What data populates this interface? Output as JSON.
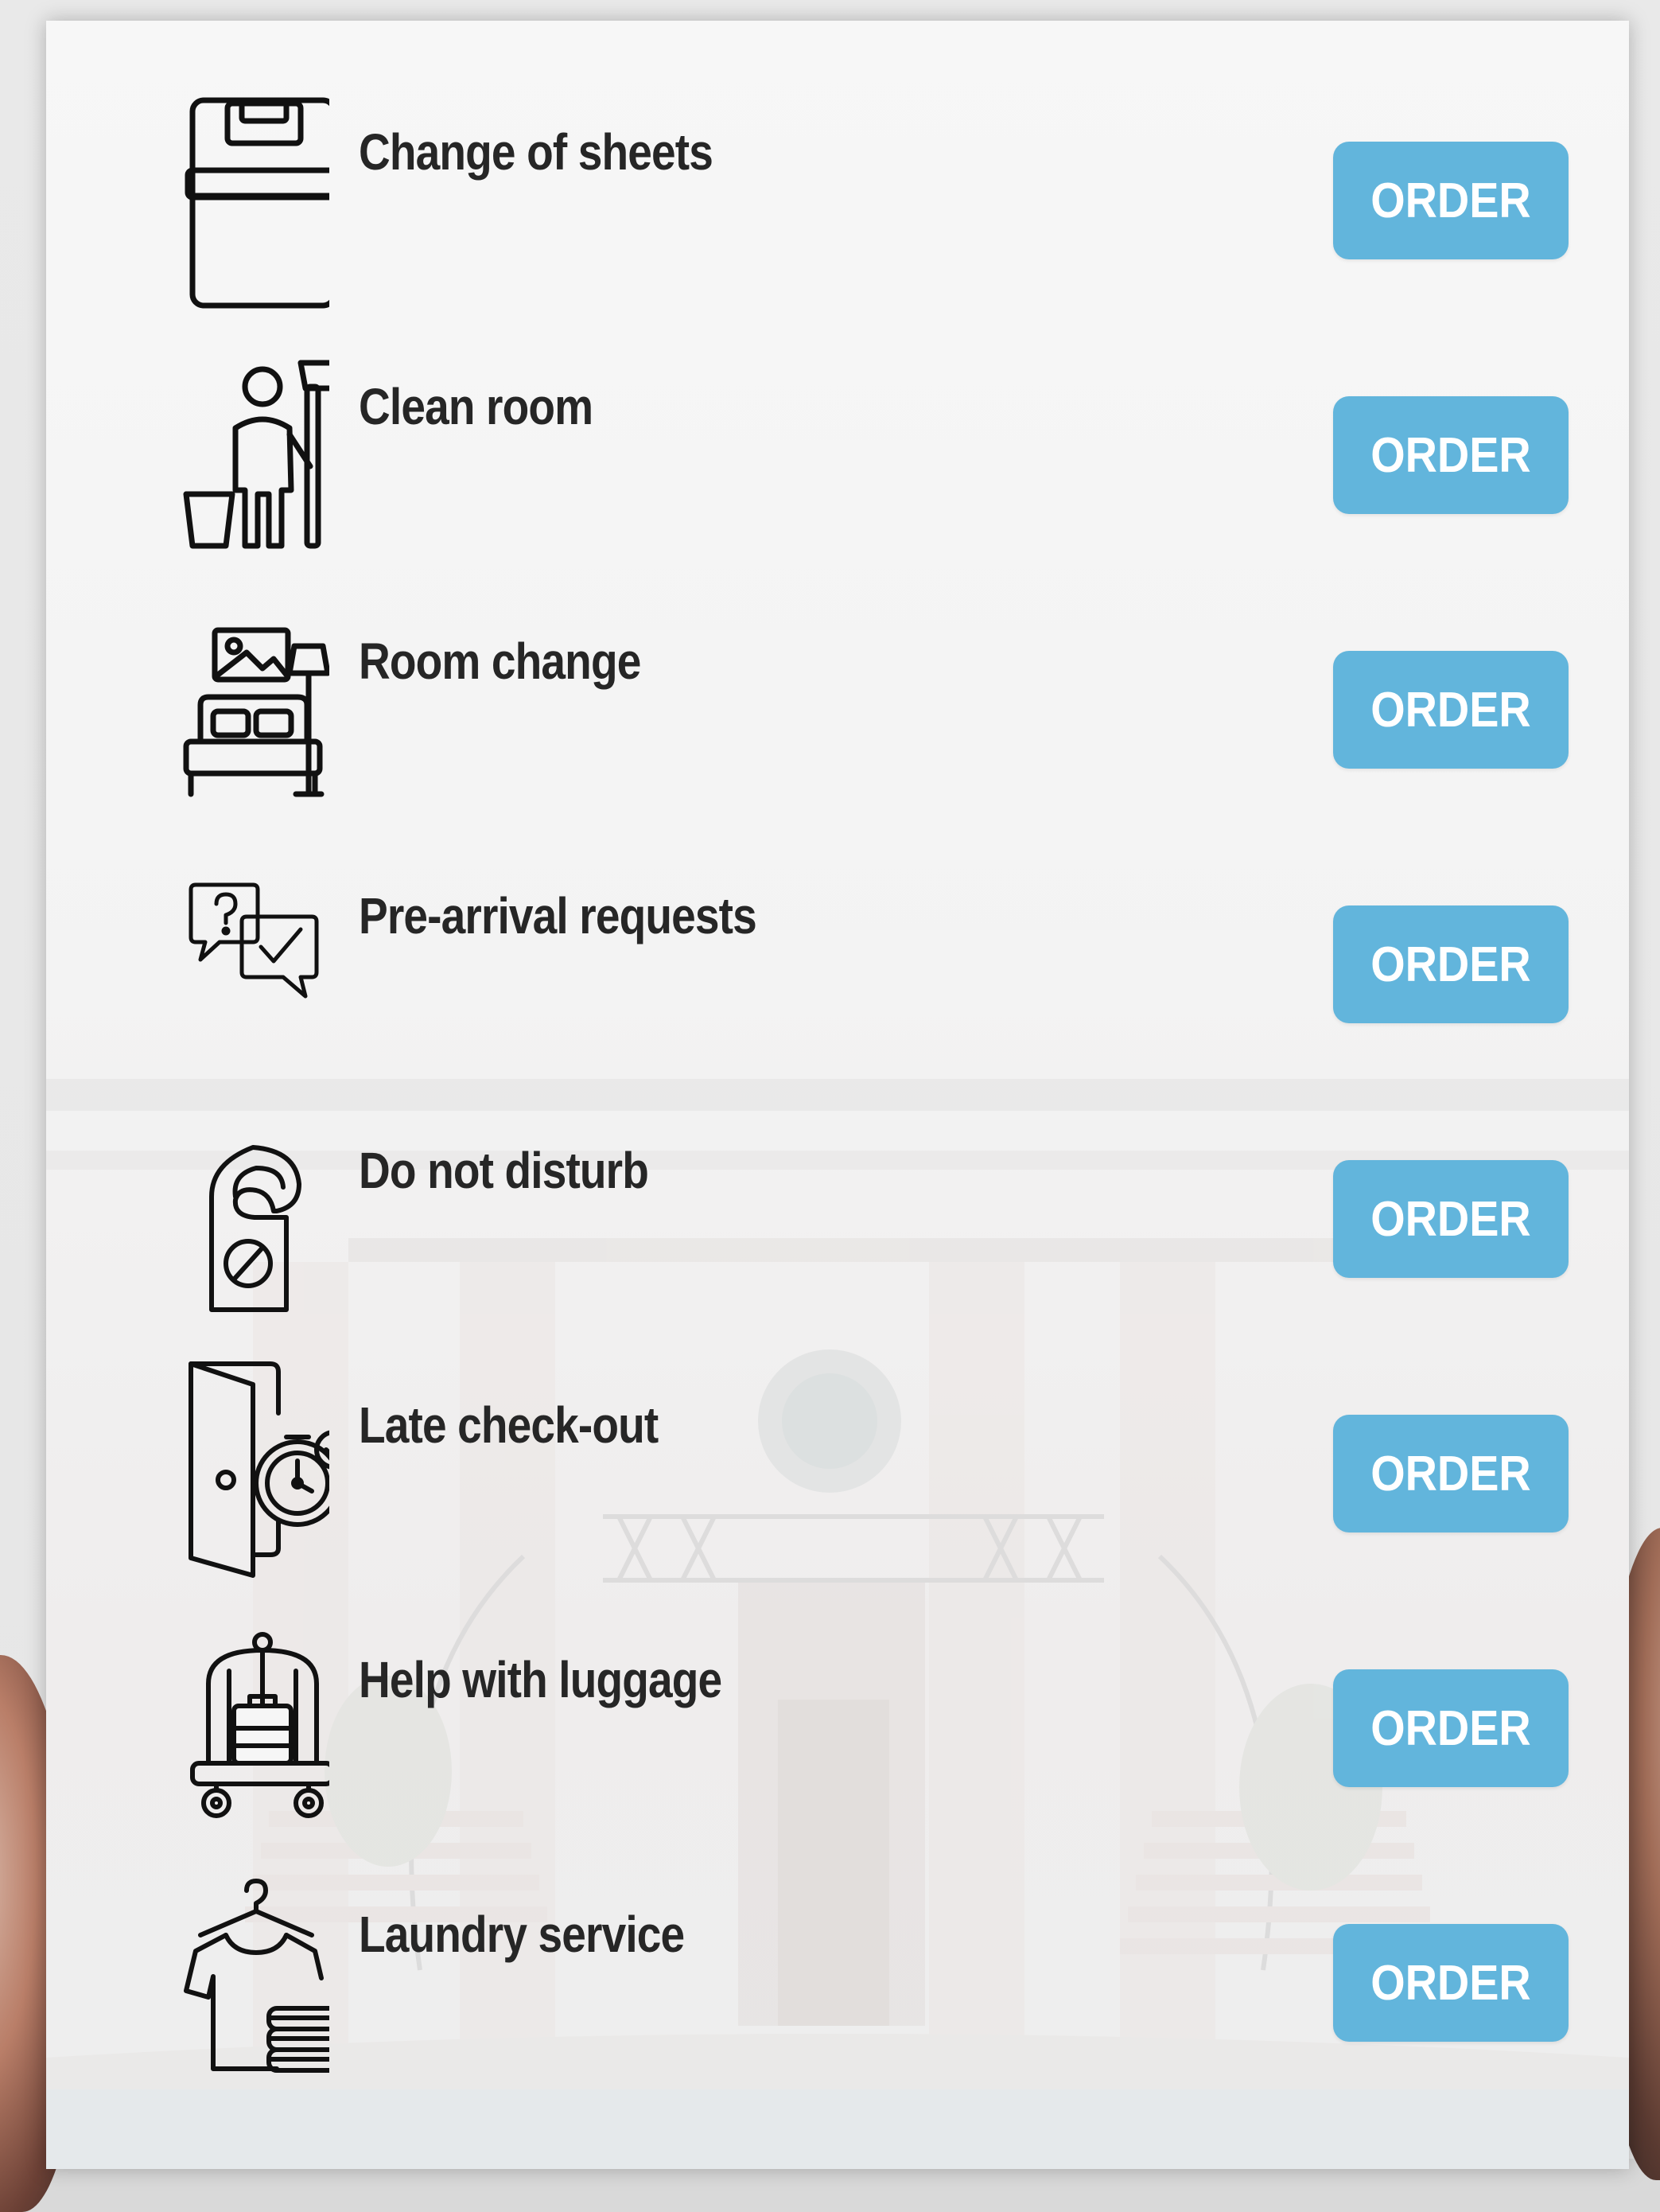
{
  "colors": {
    "button_bg": "#62b5dc",
    "button_text": "#ffffff",
    "label_text": "#262626",
    "panel_bg": "#f6f6f6"
  },
  "services": [
    {
      "label": "Change of sheets",
      "button": "ORDER",
      "icon": "bed-sheets-icon"
    },
    {
      "label": "Clean room",
      "button": "ORDER",
      "icon": "housekeeper-icon"
    },
    {
      "label": "Room change",
      "button": "ORDER",
      "icon": "hotel-room-icon"
    },
    {
      "label": "Pre-arrival requests",
      "button": "ORDER",
      "icon": "chat-question-check-icon"
    },
    {
      "label": "Do not disturb",
      "button": "ORDER",
      "icon": "door-hanger-icon"
    },
    {
      "label": "Late check-out",
      "button": "ORDER",
      "icon": "door-clock-icon"
    },
    {
      "label": "Help with luggage",
      "button": "ORDER",
      "icon": "luggage-cart-icon"
    },
    {
      "label": "Laundry service",
      "button": "ORDER",
      "icon": "laundry-icon"
    }
  ]
}
